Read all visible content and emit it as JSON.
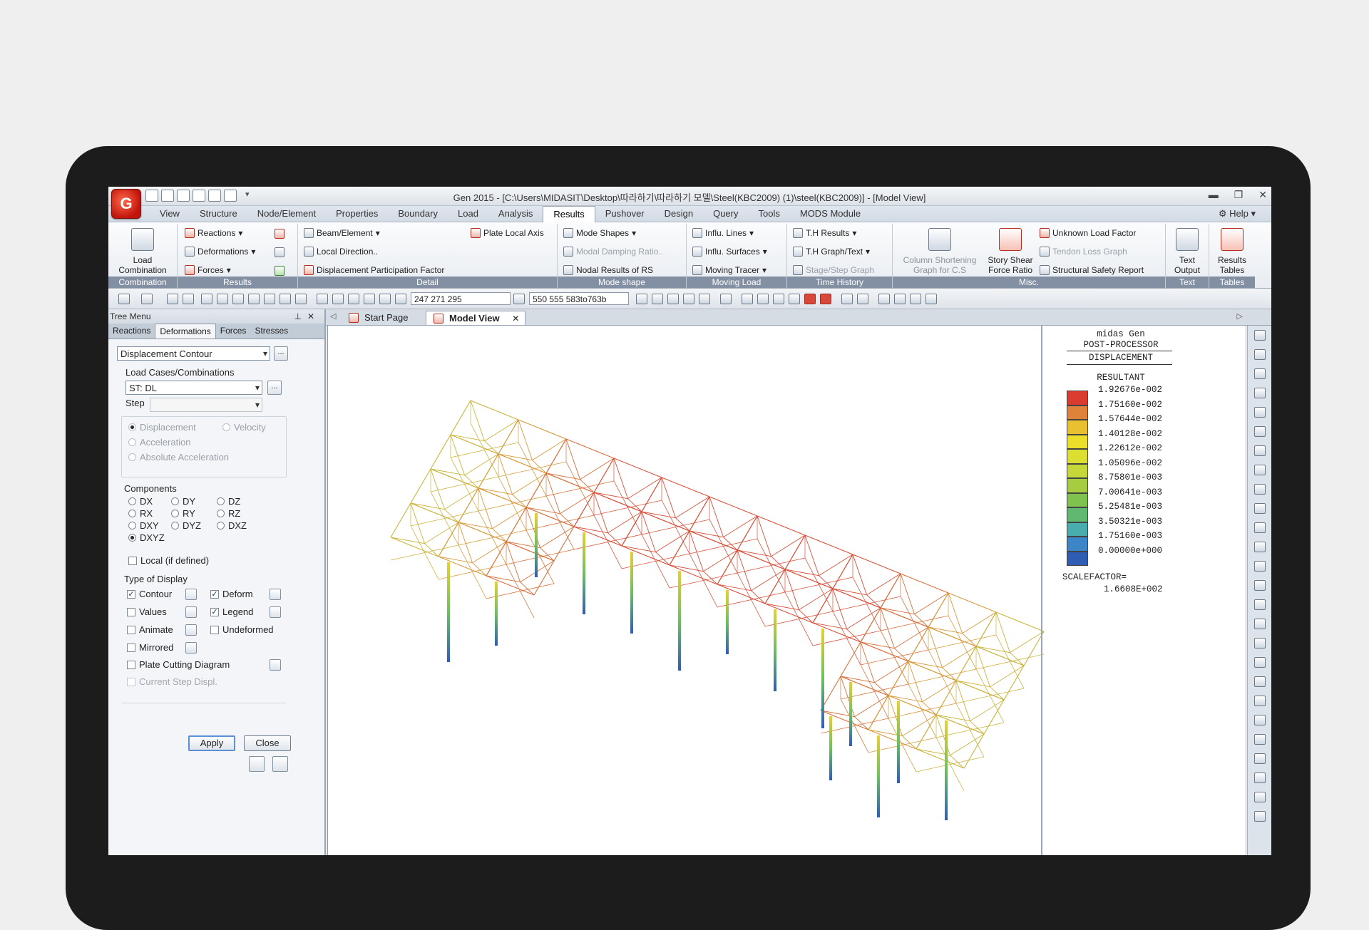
{
  "window": {
    "app_icon": "G",
    "title": "Gen 2015 - [C:\\Users\\MIDASIT\\Desktop\\따라하기\\따라하기 모델\\Steel(KBC2009) (1)\\steel(KBC2009)] - [Model View]",
    "minimize": "▬",
    "restore": "❐",
    "close": "✕"
  },
  "menu": {
    "tabs": [
      "View",
      "Structure",
      "Node/Element",
      "Properties",
      "Boundary",
      "Load",
      "Analysis",
      "Results",
      "Pushover",
      "Design",
      "Query",
      "Tools",
      "MODS Module"
    ],
    "active_tab": "Results",
    "help": "Help"
  },
  "ribbon": {
    "combination": {
      "label": "Combination",
      "load_combination": "Load\nCombination"
    },
    "results": {
      "label": "Results",
      "reactions": "Reactions",
      "deformations": "Deformations",
      "forces": "Forces"
    },
    "detail": {
      "label": "Detail",
      "beam_element": "Beam/Element",
      "local_direction": "Local Direction..",
      "displacement_participation": "Displacement Participation Factor",
      "plate_local_axis": "Plate Local Axis"
    },
    "mode_shape": {
      "label": "Mode shape",
      "mode_shapes": "Mode Shapes",
      "modal_damping": "Modal Damping Ratio..",
      "nodal_results": "Nodal Results of RS"
    },
    "moving_load": {
      "label": "Moving Load",
      "influ_lines": "Influ. Lines",
      "influ_surfaces": "Influ. Surfaces",
      "moving_tracer": "Moving Tracer"
    },
    "time_history": {
      "label": "Time History",
      "th_results": "T.H Results",
      "th_graph": "T.H Graph/Text",
      "stage_step": "Stage/Step Graph"
    },
    "misc": {
      "label": "Misc.",
      "column_shortening": "Column Shortening\nGraph for C.S",
      "story_shear": "Story Shear\nForce Ratio",
      "unknown_load": "Unknown Load Factor",
      "tendon_loss": "Tendon Loss Graph",
      "structural_safety": "Structural Safety Report"
    },
    "text": {
      "label": "Text",
      "text_output": "Text\nOutput"
    },
    "tables": {
      "label": "Tables",
      "results_tables": "Results\nTables"
    }
  },
  "toolbar": {
    "node_field": "247 271 295",
    "element_field": "550 555 583to763b"
  },
  "tree_menu": {
    "title": "Tree Menu",
    "pin": "⊥",
    "close": "✕",
    "tabs": [
      "Reactions",
      "Deformations",
      "Forces",
      "Stresses"
    ],
    "active_tab": "Deformations",
    "display_type": "Displacement Contour",
    "dots": "...",
    "load_cases_label": "Load Cases/Combinations",
    "load_case": "ST: DL",
    "step_label": "Step",
    "step_value": "",
    "mode_options": [
      "Displacement",
      "Velocity",
      "Acceleration",
      "Absolute Acceleration"
    ],
    "components_label": "Components",
    "components": [
      "DX",
      "DY",
      "DZ",
      "RX",
      "RY",
      "RZ",
      "DXY",
      "DYZ",
      "DXZ",
      "DXYZ"
    ],
    "selected_component": "DXYZ",
    "local_label": "Local (if defined)",
    "type_of_display_label": "Type of Display",
    "display_options": {
      "contour": "Contour",
      "deform": "Deform",
      "values": "Values",
      "legend": "Legend",
      "animate": "Animate",
      "undeformed": "Undeformed",
      "mirrored": "Mirrored",
      "plate_cutting": "Plate Cutting Diagram",
      "current_step": "Current Step Displ."
    },
    "apply": "Apply",
    "close_button": "Close"
  },
  "view_tabs": {
    "start_page": "Start Page",
    "model_view": "Model View",
    "close": "✕"
  },
  "legend": {
    "line1": "midas Gen",
    "line2": "POST-PROCESSOR",
    "line3": "DISPLACEMENT",
    "line4": "RESULTANT",
    "values": [
      "1.92676e-002",
      "1.75160e-002",
      "1.57644e-002",
      "1.40128e-002",
      "1.22612e-002",
      "1.05096e-002",
      "8.75801e-003",
      "7.00641e-003",
      "5.25481e-003",
      "3.50321e-003",
      "1.75160e-003",
      "0.00000e+000"
    ],
    "colors": [
      "#dc3c30",
      "#e0833a",
      "#e8c030",
      "#ecdf2a",
      "#dcdf30",
      "#c6d838",
      "#a6cc40",
      "#80c250",
      "#5fb970",
      "#49adae",
      "#3c86c8",
      "#2f5db4"
    ],
    "scale_label": "SCALEFACTOR=",
    "scale_value": "1.6608E+002"
  }
}
